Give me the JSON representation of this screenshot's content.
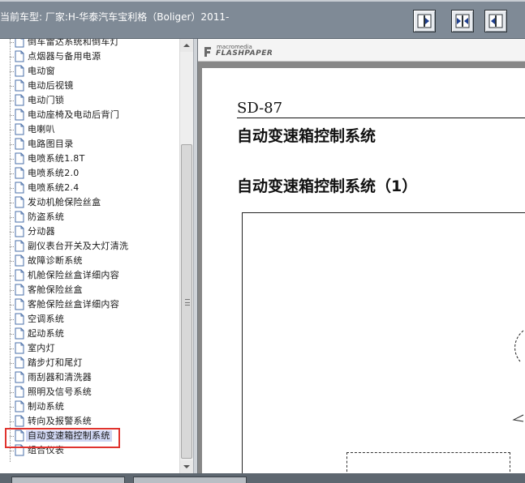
{
  "header": {
    "title": "当前车型:   厂家:H-华泰汽车宝利格（Boliger）2011-",
    "buttons": [
      {
        "icon": "split-left-icon"
      },
      {
        "icon": "split-center-icon"
      },
      {
        "icon": "split-right-icon"
      }
    ]
  },
  "tree": {
    "items": [
      {
        "label": "倒车雷达系统和倒车灯"
      },
      {
        "label": "点烟器与备用电源"
      },
      {
        "label": "电动窗"
      },
      {
        "label": "电动后视镜"
      },
      {
        "label": "电动门锁"
      },
      {
        "label": "电动座椅及电动后背门"
      },
      {
        "label": "电喇叭"
      },
      {
        "label": "电路图目录"
      },
      {
        "label": "电喷系统1.8T"
      },
      {
        "label": "电喷系统2.0"
      },
      {
        "label": "电喷系统2.4"
      },
      {
        "label": "发动机舱保险丝盒"
      },
      {
        "label": "防盗系统"
      },
      {
        "label": "分动器"
      },
      {
        "label": "副仪表台开关及大灯清洗"
      },
      {
        "label": "故障诊断系统"
      },
      {
        "label": "机舱保险丝盒详细内容"
      },
      {
        "label": "客舱保险丝盒"
      },
      {
        "label": "客舱保险丝盒详细内容"
      },
      {
        "label": "空调系统"
      },
      {
        "label": "起动系统"
      },
      {
        "label": "室内灯"
      },
      {
        "label": "踏步灯和尾灯"
      },
      {
        "label": "雨刮器和清洗器"
      },
      {
        "label": "照明及信号系统"
      },
      {
        "label": "制动系统"
      },
      {
        "label": "转向及报警系统"
      },
      {
        "label": "自动变速箱控制系统",
        "selected": true
      },
      {
        "label": "组合仪表"
      }
    ]
  },
  "viewer": {
    "brand_small": "macromedia",
    "brand_big": "FLASHPAPER",
    "page": {
      "code": "SD-87",
      "heading1": "自动变速箱控制系统",
      "heading2": "自动变速箱控制系统（1）"
    }
  },
  "colors": {
    "topbar": "#7f8a96",
    "selection": "#cfd6f2",
    "highlight": "#e0332e",
    "viewer_bg": "#878787"
  }
}
